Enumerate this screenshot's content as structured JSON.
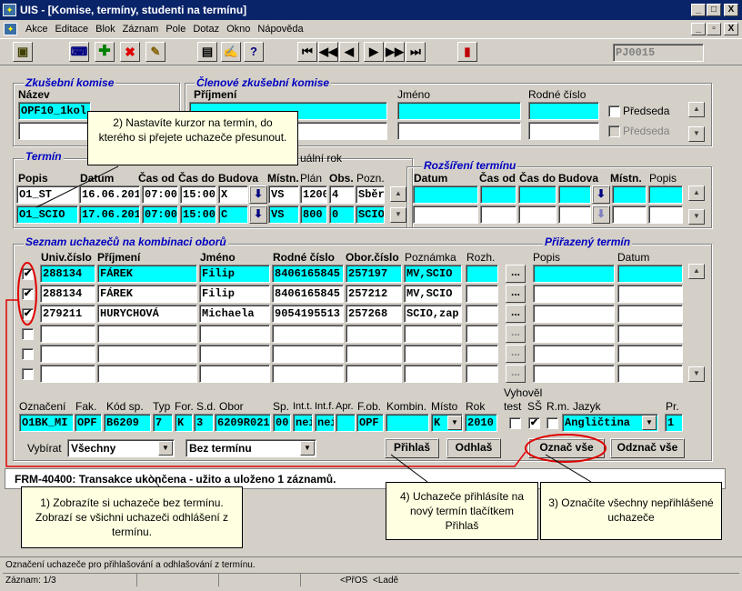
{
  "window": {
    "title": "UIS - [Komise, termíny, studenti na termínu]",
    "minimize": "_",
    "maximize": "□",
    "close": "X"
  },
  "menu": {
    "items": [
      "Akce",
      "Editace",
      "Blok",
      "Záznam",
      "Pole",
      "Dotaz",
      "Okno",
      "Nápověda"
    ]
  },
  "toolbar": {
    "record_field": "PJ0015"
  },
  "komise": {
    "title": "Zkušební komise",
    "name_label": "Název",
    "name_value": "OPF10_1kol"
  },
  "clenove": {
    "title": "Členové zkušební komise",
    "prijmeni_label": "Příjmení",
    "jmeno_label": "Jméno",
    "rc_label": "Rodné číslo",
    "predseda1": "Předseda",
    "predseda2": "Předseda"
  },
  "termin": {
    "title": "Termín",
    "year_label_fragment": "uální rok",
    "headers": {
      "popis": "Popis",
      "datum": "Datum",
      "cas_od": "Čas od",
      "cas_do": "Čas do",
      "budova": "Budova",
      "mistn": "Místn.",
      "plan": "Plán",
      "obs": "Obs.",
      "pozn": "Pozn."
    },
    "rows": [
      {
        "popis": "O1_ST",
        "datum": "16.06.2010",
        "cas_od": "07:00",
        "cas_do": "15:00",
        "budova": "X",
        "mistn": "VS",
        "plan": "1200",
        "obs": "4",
        "pozn": "Sběr"
      },
      {
        "popis": "O1_SCIO",
        "datum": "17.06.2010",
        "cas_od": "07:00",
        "cas_do": "15:00",
        "budova": "C",
        "mistn": "VS",
        "plan": "800",
        "obs": "0",
        "pozn": "SCIO"
      }
    ]
  },
  "rozsireni": {
    "title": "Rozšíření termínu",
    "datum": "Datum",
    "cas_od": "Čas od",
    "cas_do": "Čas do",
    "budova": "Budova",
    "mistn": "Místn.",
    "popis": "Popis"
  },
  "seznam": {
    "title": "Seznam uchazečů na kombinaci oborů",
    "headers": {
      "univ": "Univ.číslo",
      "prijmeni": "Příjmení",
      "jmeno": "Jméno",
      "rc": "Rodné číslo",
      "obor": "Obor.číslo",
      "poznamka": "Poznámka",
      "rozh": "Rozh."
    },
    "rows": [
      {
        "checked": "✔",
        "univ": "288134",
        "prijmeni": "FÁREK",
        "jmeno": "Filip",
        "rc": "8406165845",
        "obor": "257197",
        "poznamka": "MV,SCIO"
      },
      {
        "checked": "✔",
        "univ": "288134",
        "prijmeni": "FÁREK",
        "jmeno": "Filip",
        "rc": "8406165845",
        "obor": "257212",
        "poznamka": "MV,SCIO"
      },
      {
        "checked": "✔",
        "univ": "279211",
        "prijmeni": "HURYCHOVÁ",
        "jmeno": "Michaela",
        "rc": "9054195513",
        "obor": "257268",
        "poznamka": "SCIO,zap"
      }
    ],
    "ellipsis": "..."
  },
  "prirazeny": {
    "title": "Přiřazený termín",
    "popis": "Popis",
    "datum": "Datum"
  },
  "detail": {
    "headers": {
      "oznaceni": "Označení",
      "fak": "Fak.",
      "kod": "Kód sp.",
      "typ": "Typ",
      "for": "For.",
      "sd": "S.d.",
      "obor": "Obor",
      "sp": "Sp.",
      "intt": "Int.t.",
      "intf": "Int.f.",
      "apr": "Apr.",
      "fob": "F.ob.",
      "kombin": "Kombin.",
      "misto": "Místo",
      "rok": "Rok",
      "vyhovel": "Vyhověl",
      "test": "test",
      "ss": "SŠ",
      "rm": "R.m.",
      "jazyk": "Jazyk",
      "pr": "Pr."
    },
    "values": {
      "oznaceni": "O1BK_MI",
      "fak": "OPF",
      "kod": "B6209",
      "typ": "7",
      "for": "K",
      "sd": "3",
      "obor": "6209R021",
      "sp": "00",
      "intt": "nei",
      "intf": "nei",
      "apr": "",
      "fob": "OPF",
      "kombin": "",
      "misto": "K",
      "rok": "2010",
      "ss_check": "✔",
      "jazyk": "Angličtina",
      "pr": "1"
    }
  },
  "filters": {
    "vybirat_label": "Vybírat",
    "vybirat_value": "Všechny",
    "termin_filter": "Bez termínu"
  },
  "buttons": {
    "prihlas": "Přihlaš",
    "odhlas": "Odhlaš",
    "oznac": "Označ vše",
    "odznac": "Odznač vše"
  },
  "message": {
    "text": "FRM-40400: Transakce ukončena - užito a uloženo 1 záznamů."
  },
  "callouts": {
    "c1": "2) Nastavíte kurzor na termín, do kterého si přejete uchazeče přesunout.",
    "c2": "1) Zobrazíte si uchazeče bez termínu. Zobrazí se všichni uchazeči odhlášení z termínu.",
    "c3": "4) Uchazeče přihlásíte na nový termín tlačítkem Přihlaš",
    "c4": "3) Označíte všechny nepřihlášené uchazeče"
  },
  "status": {
    "hint": "Označení uchazeče pro přihlašování a odhlašování z termínu.",
    "record": "Záznam: 1/3",
    "seg1": "<PřOS",
    "seg2": "<Ladě"
  },
  "colors": {
    "field_highlight": "#00ffff",
    "callout_bg": "#ffffe1",
    "annotation": "#e00000",
    "group_title": "#0000c0"
  }
}
